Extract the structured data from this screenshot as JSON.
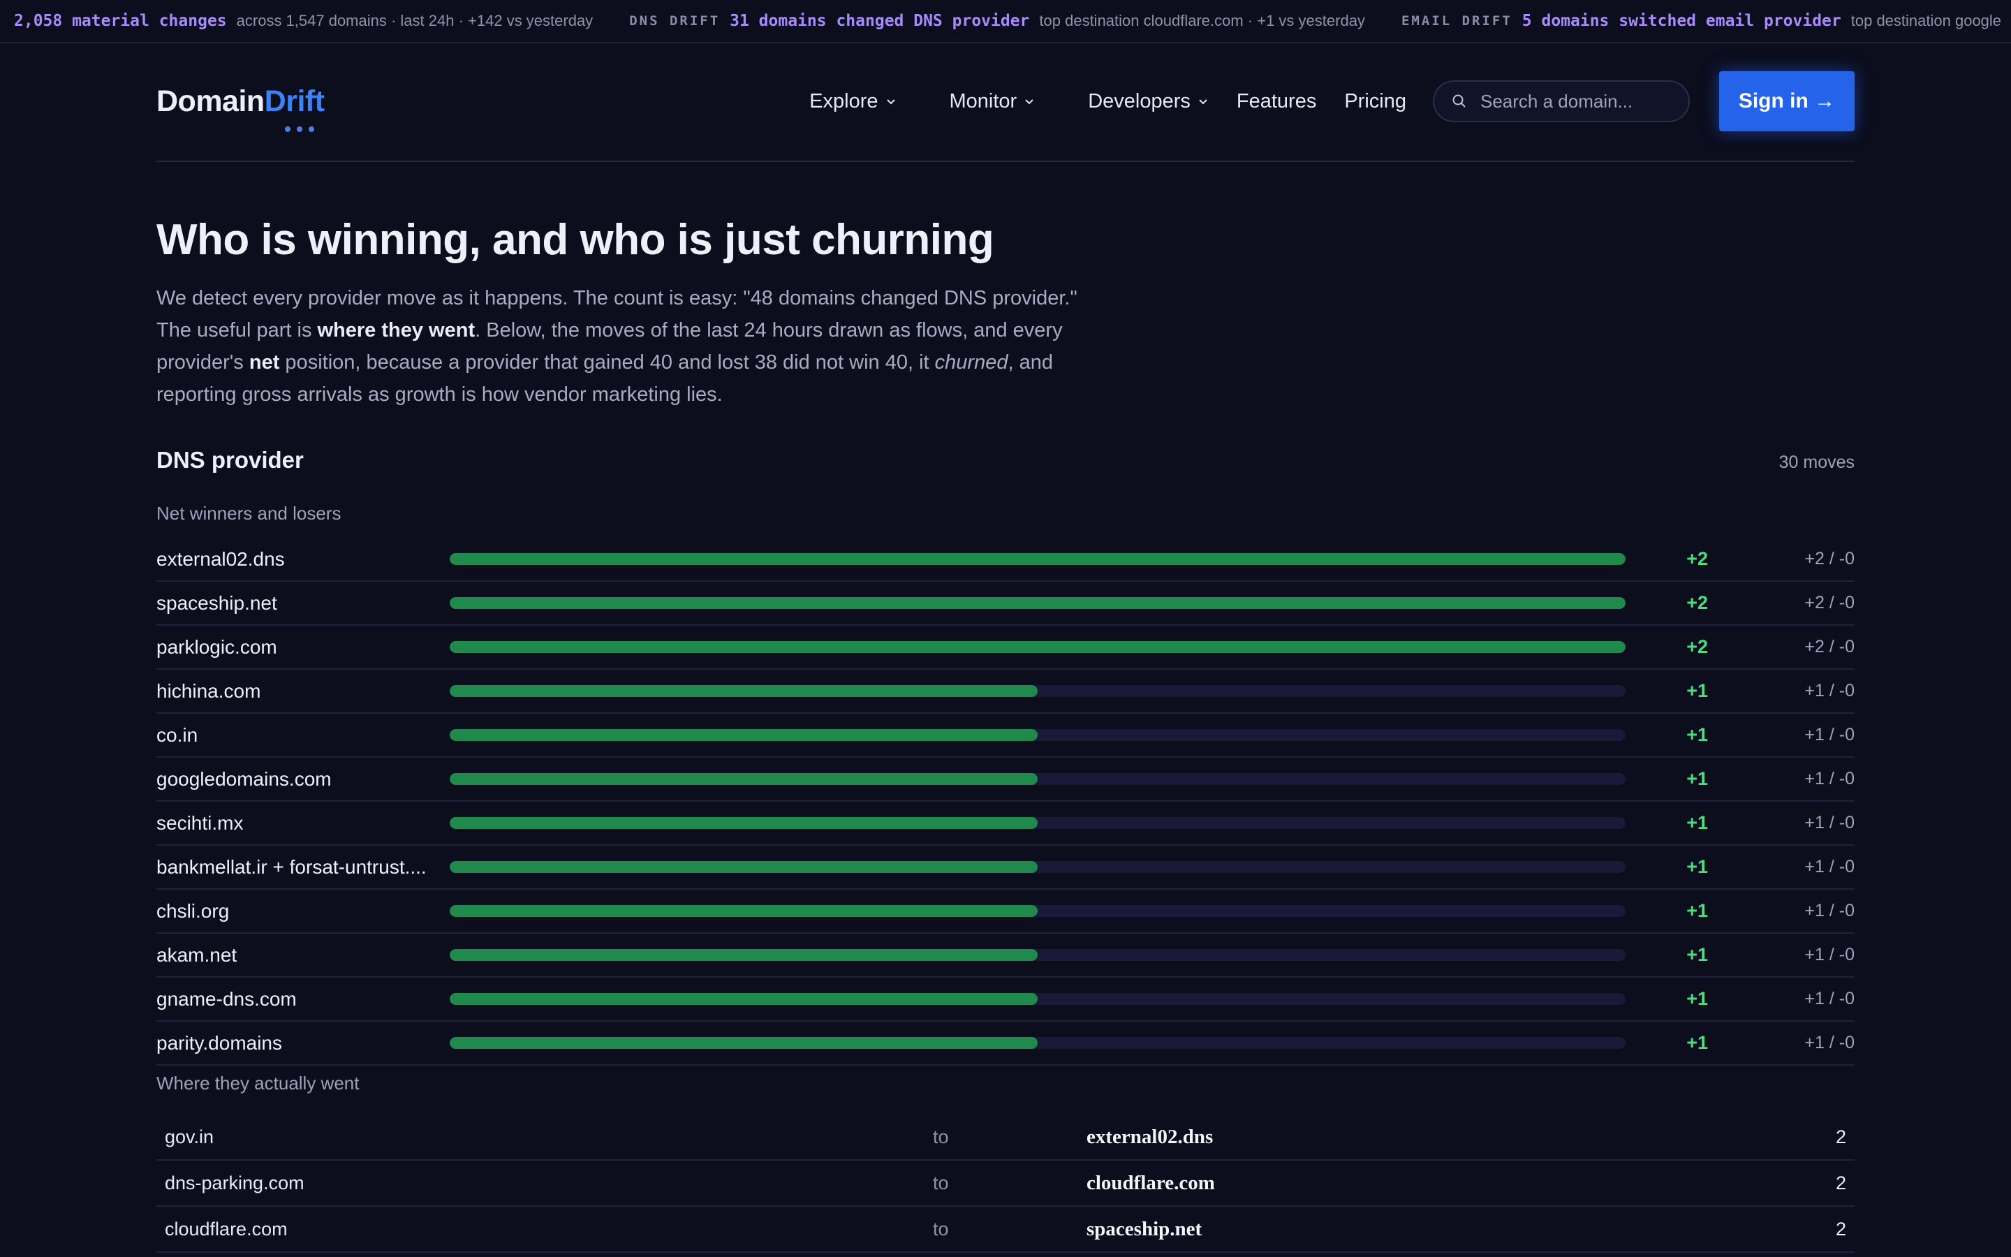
{
  "ticker": [
    {
      "kicker": "",
      "bold": "2,058 material changes",
      "rest": "across 1,547 domains · last 24h · +142 vs yesterday"
    },
    {
      "kicker": "DNS DRIFT",
      "bold": "31 domains changed DNS provider",
      "rest": "top destination cloudflare.com · +1 vs yesterday"
    },
    {
      "kicker": "EMAIL DRIFT",
      "bold": "5 domains switched email provider",
      "rest": "top destination google"
    }
  ],
  "brand": {
    "name_main": "Domain",
    "name_accent": "Drift",
    "accent_color": "#3b82f6"
  },
  "nav": {
    "explore": "Explore",
    "monitor": "Monitor",
    "developers": "Developers",
    "features": "Features",
    "pricing": "Pricing",
    "search_placeholder": "Search a domain...",
    "sign_in": "Sign in →"
  },
  "page": {
    "title": "Who is winning, and who is just churning",
    "intro": {
      "p1": "We detect every provider move as it happens. The count is easy: \"48 domains changed DNS provider.\" The useful part is ",
      "b1": "where they went",
      "p2": ". Below, the moves of the last 24 hours drawn as flows, and every provider's ",
      "b2": "net",
      "p3": " position, because a provider that gained 40 and lost 38 did not win 40, it ",
      "i1": "churned",
      "p4": ", and reporting gross arrivals as growth is how vendor marketing lies."
    }
  },
  "section": {
    "title": "DNS provider",
    "moves": "30 moves",
    "winners_label": "Net winners and losers",
    "flows_label": "Where they actually went"
  },
  "winners_max": 2,
  "winners": [
    {
      "name": "external02.dns",
      "net_value": 2,
      "net": "+2",
      "gl": "+2 / -0"
    },
    {
      "name": "spaceship.net",
      "net_value": 2,
      "net": "+2",
      "gl": "+2 / -0"
    },
    {
      "name": "parklogic.com",
      "net_value": 2,
      "net": "+2",
      "gl": "+2 / -0"
    },
    {
      "name": "hichina.com",
      "net_value": 1,
      "net": "+1",
      "gl": "+1 / -0"
    },
    {
      "name": "co.in",
      "net_value": 1,
      "net": "+1",
      "gl": "+1 / -0"
    },
    {
      "name": "googledomains.com",
      "net_value": 1,
      "net": "+1",
      "gl": "+1 / -0"
    },
    {
      "name": "secihti.mx",
      "net_value": 1,
      "net": "+1",
      "gl": "+1 / -0"
    },
    {
      "name": "bankmellat.ir + forsat-untrust....",
      "net_value": 1,
      "net": "+1",
      "gl": "+1 / -0"
    },
    {
      "name": "chsli.org",
      "net_value": 1,
      "net": "+1",
      "gl": "+1 / -0"
    },
    {
      "name": "akam.net",
      "net_value": 1,
      "net": "+1",
      "gl": "+1 / -0"
    },
    {
      "name": "gname-dns.com",
      "net_value": 1,
      "net": "+1",
      "gl": "+1 / -0"
    },
    {
      "name": "parity.domains",
      "net_value": 1,
      "net": "+1",
      "gl": "+1 / -0"
    }
  ],
  "flows": [
    {
      "from": "gov.in",
      "to": "to",
      "dest": "external02.dns",
      "count": "2"
    },
    {
      "from": "dns-parking.com",
      "to": "to",
      "dest": "cloudflare.com",
      "count": "2"
    },
    {
      "from": "cloudflare.com",
      "to": "to",
      "dest": "spaceship.net",
      "count": "2"
    }
  ],
  "colors": {
    "background": "#0c0d1d",
    "positive": "#4ade80",
    "bar_fill": "#1f8a4c",
    "bar_track": "#1a1a38",
    "ticker_highlight": "#a78bfa",
    "button": "#2563eb"
  }
}
